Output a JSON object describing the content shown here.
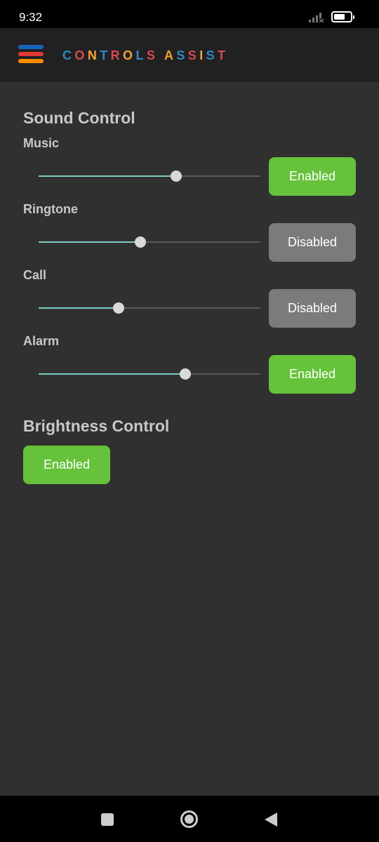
{
  "status_bar": {
    "time": "9:32",
    "battery_level": 0.7
  },
  "app_bar": {
    "title_letters": [
      "C",
      "O",
      "N",
      "T",
      "R",
      "O",
      "L",
      "S",
      " ",
      "A",
      "S",
      "S",
      "I",
      "S",
      "T"
    ],
    "title_colors": [
      "#2f87c5",
      "#d64a53",
      "#f2a23a"
    ],
    "menu_colors": [
      "#1565c0",
      "#e53935",
      "#fb8c00"
    ]
  },
  "sound": {
    "heading": "Sound Control",
    "items": [
      {
        "label": "Music",
        "value": 0.62,
        "button": "Enabled",
        "enabled": true
      },
      {
        "label": "Ringtone",
        "value": 0.46,
        "button": "Disabled",
        "enabled": false
      },
      {
        "label": "Call",
        "value": 0.36,
        "button": "Disabled",
        "enabled": false
      },
      {
        "label": "Alarm",
        "value": 0.66,
        "button": "Enabled",
        "enabled": true
      }
    ]
  },
  "brightness": {
    "heading": "Brightness Control",
    "button": "Enabled",
    "enabled": true
  },
  "colors": {
    "enabled": "#66c23a",
    "disabled": "#7c7b7c"
  }
}
